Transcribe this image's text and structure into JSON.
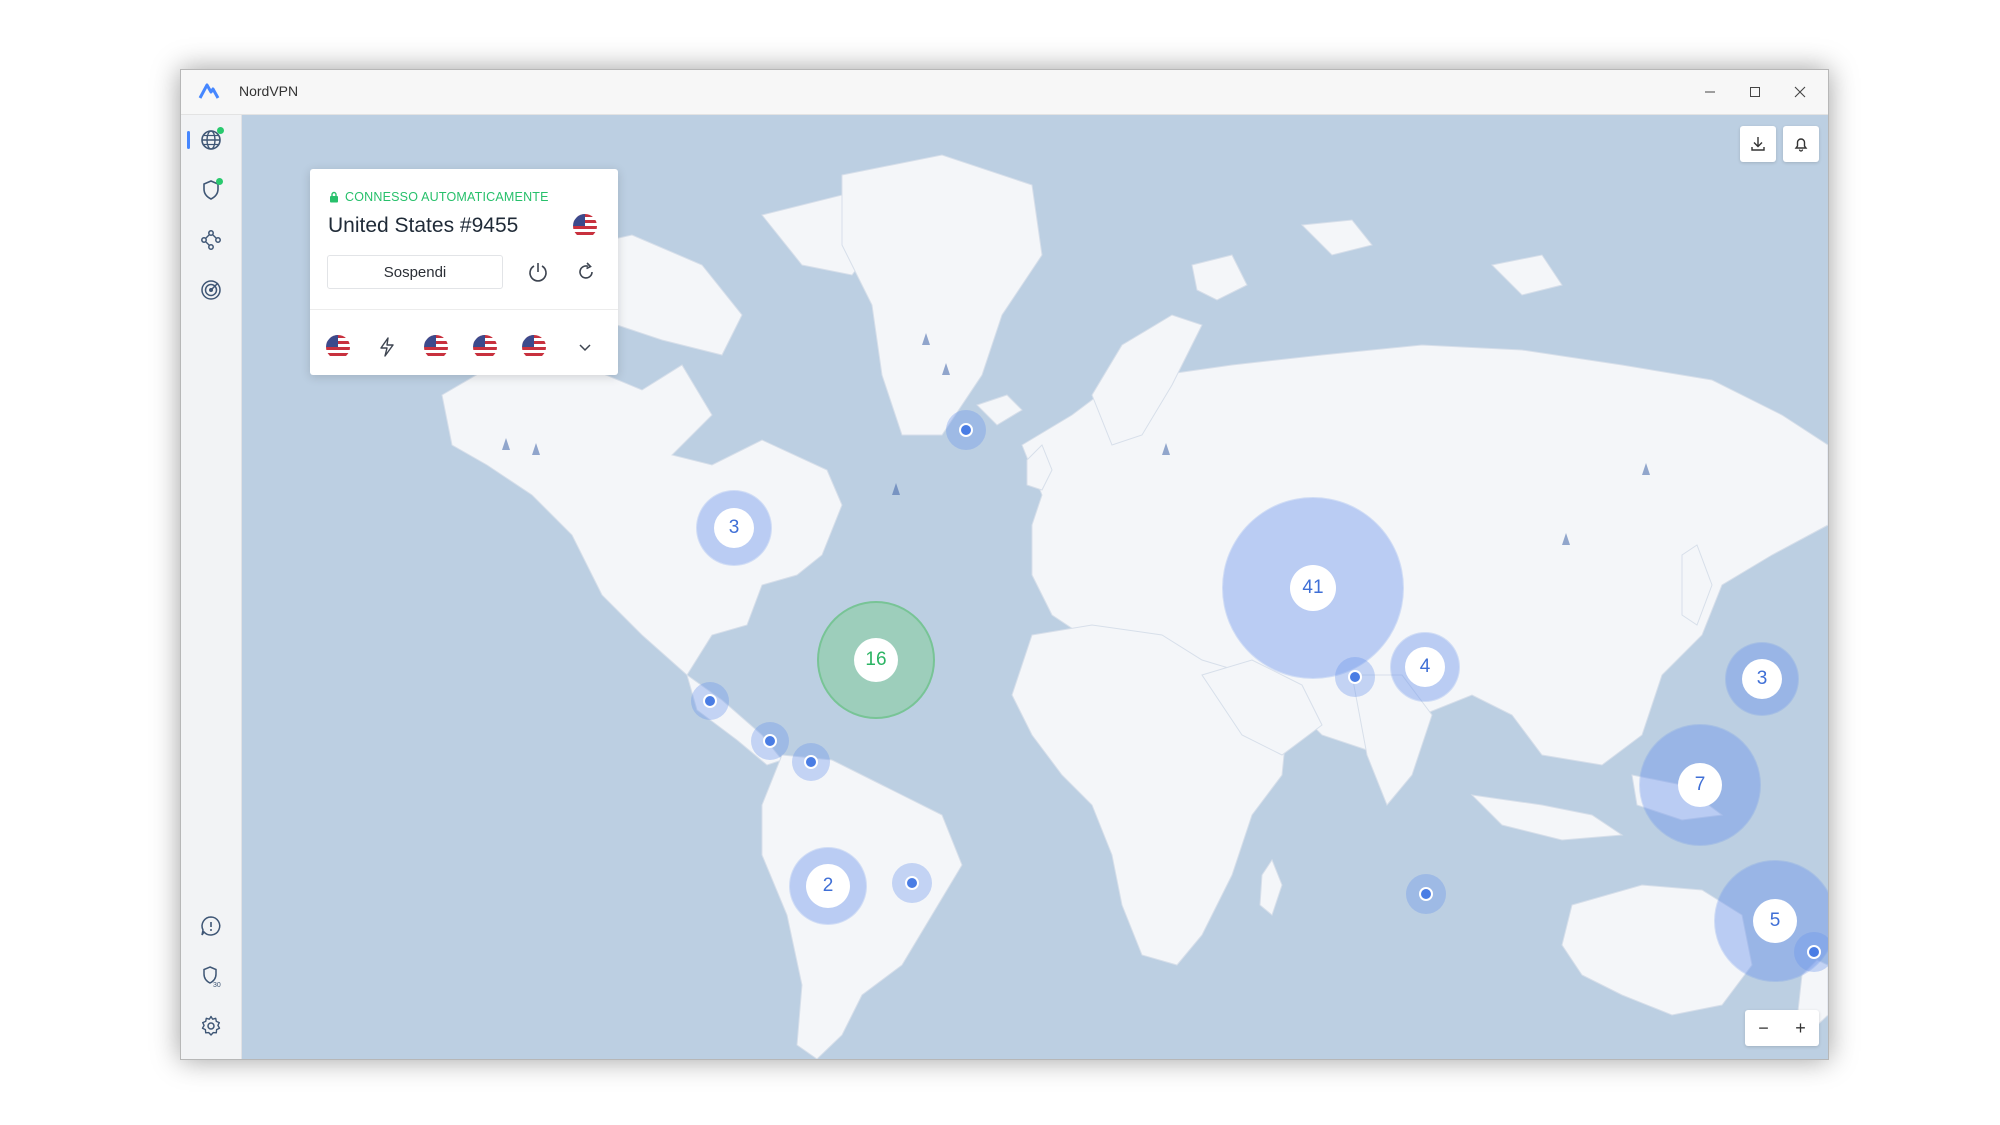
{
  "window": {
    "title": "NordVPN"
  },
  "connection": {
    "status": "CONNESSO AUTOMATICAMENTE",
    "server": "United States #9455",
    "pause_label": "Sospendi"
  },
  "quick_connect": {
    "items": [
      "us-flag",
      "lightning-icon",
      "us-flag",
      "us-flag",
      "us-flag",
      "chevron-down-icon"
    ]
  },
  "sidebar": {
    "top": [
      "globe-icon",
      "shield-icon",
      "meshnet-icon",
      "target-icon"
    ],
    "bottom": [
      "help-icon",
      "shield-30-icon",
      "gear-icon"
    ]
  },
  "clusters": {
    "canada": "3",
    "usa": "16",
    "europe": "41",
    "middle_east": "4",
    "east_asia": "3",
    "southeast_asia": "7",
    "australia": "5",
    "south_america": "2"
  },
  "map_controls": {
    "zoom_out": "−",
    "zoom_in": "+"
  },
  "colors": {
    "accent": "#4687ff",
    "connected": "#27c06b",
    "ocean": "#bccfe2",
    "land": "#f4f6f9"
  }
}
